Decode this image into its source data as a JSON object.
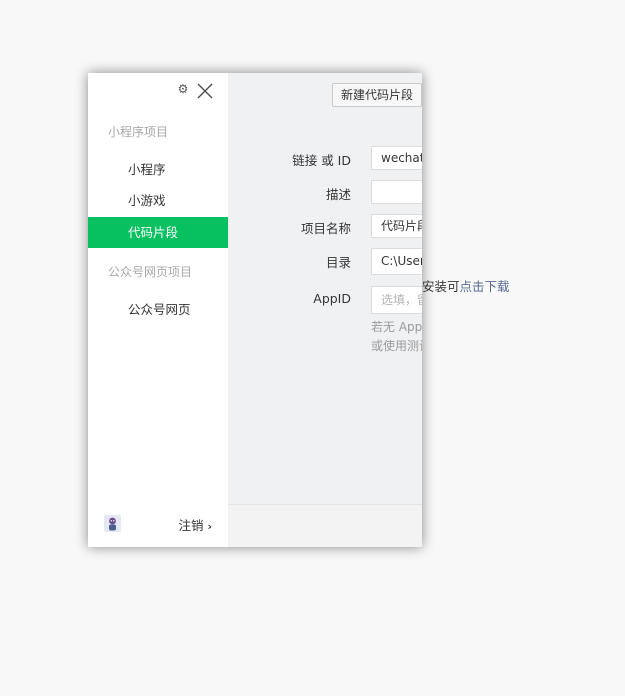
{
  "sidebar": {
    "sections": [
      {
        "title": "小程序项目",
        "items": [
          "小程序",
          "小游戏",
          "代码片段"
        ]
      },
      {
        "title": "公众号网页项目",
        "items": [
          "公众号网页"
        ]
      }
    ],
    "active_item": "代码片段",
    "footer": {
      "logout_label": "注销"
    }
  },
  "toolbar": {
    "new_snippet_label": "新建代码片段"
  },
  "form": {
    "link_or_id": {
      "label": "链接 或 ID",
      "value": "wechatide://minipr"
    },
    "description": {
      "label": "描述",
      "value": ""
    },
    "project_name": {
      "label": "项目名称",
      "value": "代码片段"
    },
    "directory": {
      "label": "目录",
      "value": "C:\\Users"
    },
    "appid": {
      "label": "AppID",
      "placeholder": "选填，留空则使用测试号"
    },
    "appid_hint_line1": "若无 AppID 可注册",
    "appid_hint_line2": "或使用测试号"
  },
  "overflow_notice": {
    "text": "安装可",
    "link": "点击下载"
  },
  "colors": {
    "accent": "#07c160",
    "link": "#576b95"
  }
}
